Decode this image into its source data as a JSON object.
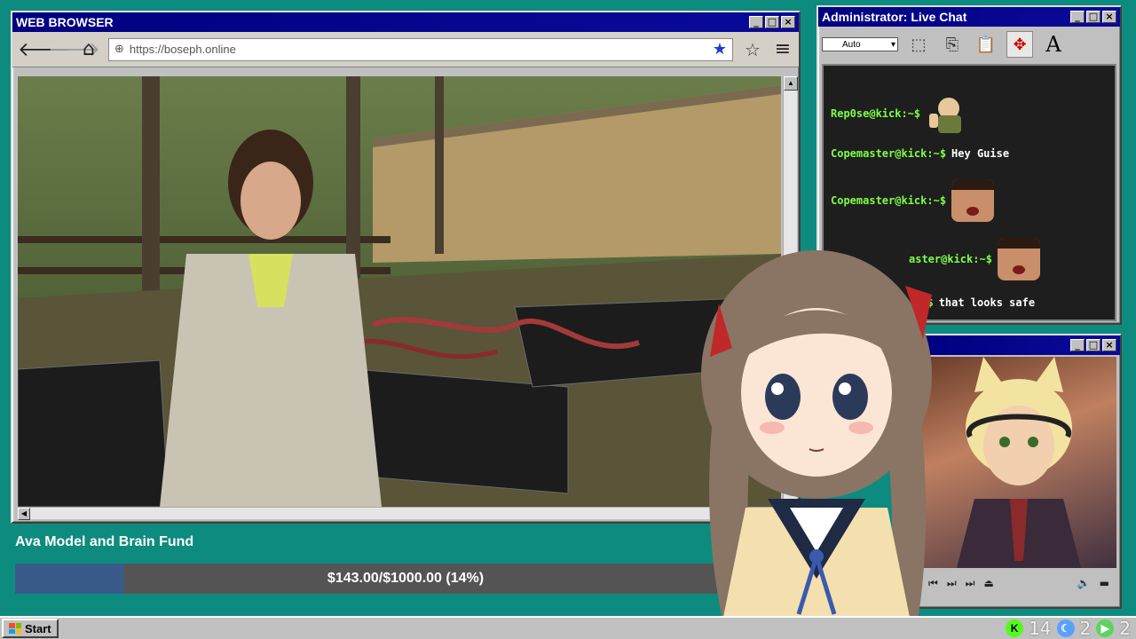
{
  "browser": {
    "title": "WEB BROWSER",
    "url_placeholder": "https://boseph.online",
    "url": "https://boseph.online"
  },
  "chat": {
    "title": "Administrator: Live Chat",
    "font_select": "Auto",
    "messages": [
      {
        "user": "Rep0se@kick:~$",
        "text": "",
        "emote": "thumbs-up-soldier"
      },
      {
        "user": "Copemaster@kick:~$",
        "text": "Hey Guise",
        "emote": ""
      },
      {
        "user": "Copemaster@kick:~$",
        "text": "",
        "emote": "face"
      },
      {
        "user": "aster@kick:~$",
        "text": "",
        "emote": "face"
      },
      {
        "user": ":~$",
        "text": "that looks safe",
        "emote": ""
      }
    ]
  },
  "fund": {
    "title": "Ava Model and Brain Fund",
    "label": "$143.00/$1000.00 (14%)",
    "progress": 0.14
  },
  "taskbar": {
    "start_label": "Start",
    "tray": [
      {
        "icon": "kick-icon",
        "value": "14",
        "color": "#53fc18"
      },
      {
        "icon": "moon-icon",
        "value": "2",
        "color": "#5aa0ff"
      },
      {
        "icon": "play-icon",
        "value": "2",
        "color": "#5fd35f"
      }
    ]
  },
  "colors": {
    "desktop": "#0e8b7f",
    "titlebar": "#000080",
    "chat_user": "#7dff4a"
  }
}
